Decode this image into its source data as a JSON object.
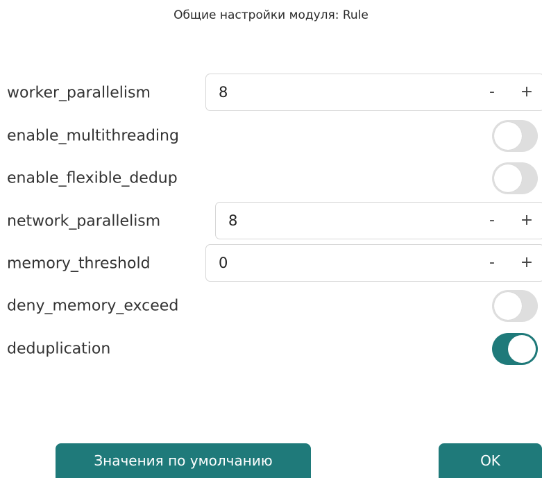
{
  "dialog": {
    "title": "Общие настройки модуля: Rule"
  },
  "settings": [
    {
      "key": "worker_parallelism",
      "type": "number",
      "value": "8"
    },
    {
      "key": "enable_multithreading",
      "type": "toggle",
      "on": false
    },
    {
      "key": "enable_flexible_dedup",
      "type": "toggle",
      "on": false
    },
    {
      "key": "network_parallelism",
      "type": "number",
      "value": "8"
    },
    {
      "key": "memory_threshold",
      "type": "number",
      "value": "0"
    },
    {
      "key": "deny_memory_exceed",
      "type": "toggle",
      "on": false
    },
    {
      "key": "deduplication",
      "type": "toggle",
      "on": true
    }
  ],
  "spin": {
    "minus": "-",
    "plus": "+"
  },
  "buttons": {
    "defaults_label": "Значения по умолчанию",
    "ok_label": "OK"
  },
  "colors": {
    "accent": "#1f7a7a",
    "toggle_off": "#dedede"
  }
}
